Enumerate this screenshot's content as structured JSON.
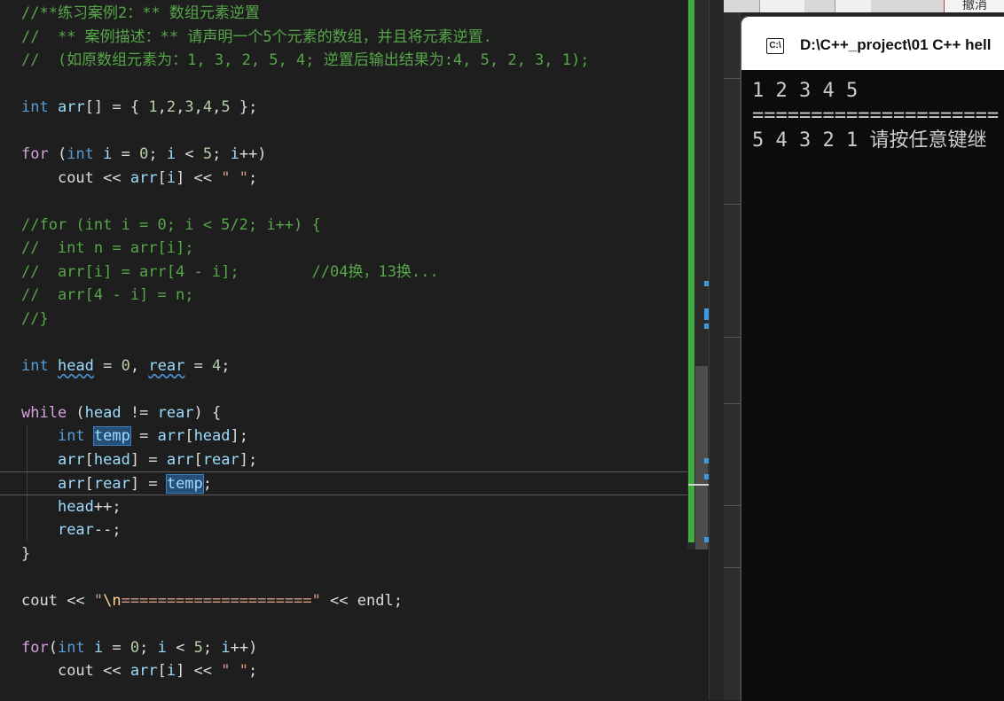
{
  "editor": {
    "lines": [
      "//**练习案例2：** 数组元素逆置",
      "//  ** 案例描述：** 请声明一个5个元素的数组，并且将元素逆置.",
      "//  (如原数组元素为：1, 3, 2, 5, 4; 逆置后输出结果为:4, 5, 2, 3, 1);",
      "",
      "int arr[] = { 1,2,3,4,5 };",
      "",
      "for (int i = 0; i < 5; i++)",
      "    cout << arr[i] << \" \";",
      "",
      "//for (int i = 0; i < 5/2; i++) {",
      "//  int n = arr[i];",
      "//  arr[i] = arr[4 - i];        //04换，13换...",
      "//  arr[4 - i] = n;",
      "//}",
      "",
      "int head = 0, rear = 4;",
      "",
      "while (head != rear) {",
      "    int temp = arr[head];",
      "    arr[head] = arr[rear];",
      "    arr[rear] = temp;",
      "    head++;",
      "    rear--;",
      "}",
      "",
      "cout << \"\\n=====================\" << endl;",
      "",
      "for(int i = 0; i < 5; i++)",
      "    cout << arr[i] << \" \";"
    ],
    "highlight_word": "temp"
  },
  "console": {
    "title": "D:\\C++_project\\01 C++ hell",
    "icon_label": "C:\\",
    "output": [
      "1 2 3 4 5",
      "=====================",
      "5 4 3 2 1 请按任意键继"
    ]
  },
  "toolbar": {
    "undo_label": "撤消"
  },
  "colors": {
    "editor_bg": "#1e1e1e",
    "keyword": "#569cd6",
    "control_keyword": "#d8a0df",
    "comment": "#57a64a",
    "string": "#d69d85",
    "identifier": "#9cdcfe",
    "console_bg": "#0c0c0c",
    "scroll_change_bar": "#3fae3f"
  }
}
